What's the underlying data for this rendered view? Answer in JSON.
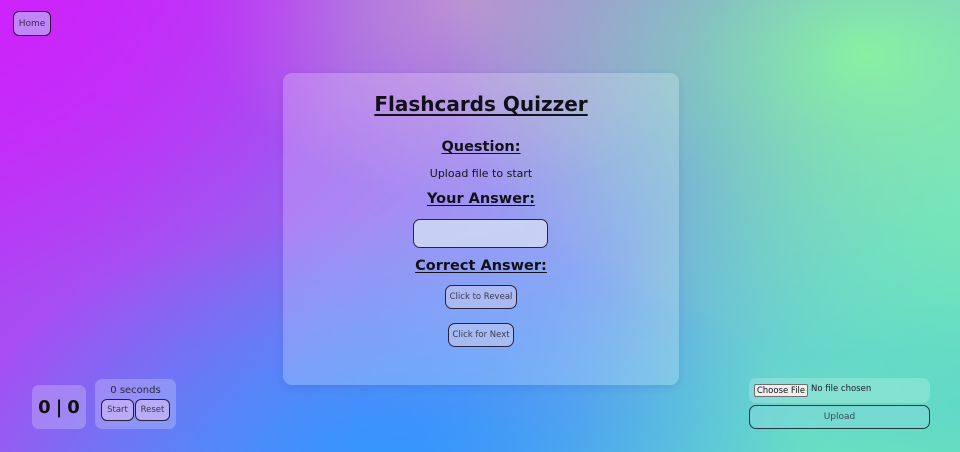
{
  "nav": {
    "home_label": "Home"
  },
  "card": {
    "title": "Flashcards Quizzer",
    "question_label": "Question:",
    "question_text": "Upload file to start",
    "answer_label": "Your Answer:",
    "answer_value": "",
    "correct_label": "Correct Answer:",
    "reveal_label": "Click to Reveal",
    "next_label": "Click for Next"
  },
  "score": {
    "correct": "0",
    "separator": "|",
    "incorrect": "0"
  },
  "timer": {
    "text": "0 seconds",
    "start_label": "Start",
    "reset_label": "Reset"
  },
  "upload": {
    "choose_label": "Choose File",
    "file_status": "No file chosen",
    "upload_label": "Upload"
  }
}
